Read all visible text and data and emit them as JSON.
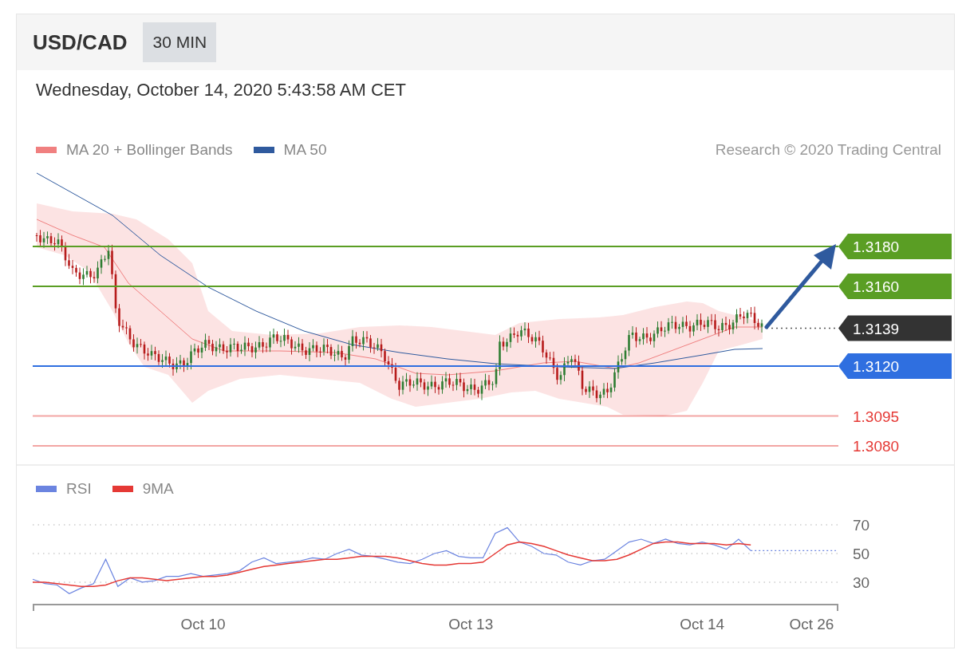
{
  "header": {
    "symbol": "USD/CAD",
    "timeframe": "30 MIN"
  },
  "timestamp": "Wednesday, October 14, 2020 5:43:58 AM CET",
  "price_chart": {
    "legend": [
      {
        "label": "MA 20 + Bollinger Bands",
        "color": "#f08080"
      },
      {
        "label": "MA 50",
        "color": "#2f5a9e"
      }
    ],
    "credit": "Research © 2020 Trading Central",
    "levels": [
      {
        "label": "1.3180",
        "kind": "tag",
        "color": "#5a9e24"
      },
      {
        "label": "1.3160",
        "kind": "tag",
        "color": "#5a9e24"
      },
      {
        "label": "1.3139",
        "kind": "current",
        "color": "#333333"
      },
      {
        "label": "1.3120",
        "kind": "tag",
        "color": "#2f6fe0"
      },
      {
        "label": "1.3095",
        "kind": "plain",
        "color": "#e53935"
      },
      {
        "label": "1.3080",
        "kind": "plain",
        "color": "#e53935"
      }
    ]
  },
  "rsi_chart": {
    "chart_data": {
      "type": "line",
      "categories": [
        null,
        null,
        null,
        null,
        null,
        null,
        null,
        null,
        null,
        null,
        null,
        null,
        null,
        null,
        "Oct 10",
        null,
        null,
        null,
        null,
        null,
        null,
        null,
        null,
        null,
        null,
        null,
        null,
        null,
        null,
        null,
        null,
        null,
        null,
        null,
        null,
        null,
        "Oct 13",
        null,
        null,
        null,
        null,
        null,
        null,
        null,
        null,
        null,
        null,
        null,
        null,
        null,
        null,
        null,
        null,
        null,
        null,
        "Oct 14",
        null,
        null,
        null,
        null,
        null,
        null,
        null,
        null,
        "Oct 26",
        null,
        null
      ],
      "series": [
        {
          "name": "RSI",
          "color": "#6b84e0",
          "values": [
            32,
            29,
            28,
            22,
            26,
            29,
            46,
            27,
            33,
            30,
            31,
            34,
            34,
            36,
            34,
            35,
            36,
            38,
            44,
            47,
            43,
            44,
            45,
            47,
            46,
            50,
            53,
            49,
            48,
            46,
            44,
            43,
            46,
            50,
            52,
            48,
            47,
            47,
            64,
            68,
            58,
            55,
            50,
            49,
            44,
            42,
            45,
            46,
            52,
            58,
            60,
            57,
            60,
            57,
            56,
            58,
            56,
            53,
            60,
            52,
            null,
            null,
            null,
            null,
            null,
            null,
            null
          ]
        },
        {
          "name": "9MA",
          "color": "#e53935",
          "values": [
            30,
            30,
            29,
            28,
            27,
            27,
            28,
            31,
            33,
            33,
            32,
            31,
            32,
            33,
            34,
            34,
            35,
            37,
            39,
            41,
            42,
            43,
            44,
            45,
            46,
            46,
            47,
            48,
            48,
            48,
            47,
            45,
            43,
            42,
            42,
            43,
            43,
            44,
            50,
            56,
            58,
            57,
            55,
            52,
            49,
            47,
            45,
            45,
            46,
            49,
            53,
            57,
            58,
            58,
            57,
            57,
            57,
            56,
            57,
            56,
            null,
            null,
            null,
            null,
            null,
            null,
            null
          ]
        },
        {
          "color": "#6b84e0",
          "line_style": "dotted",
          "values": [
            null,
            null,
            null,
            null,
            null,
            null,
            null,
            null,
            null,
            null,
            null,
            null,
            null,
            null,
            null,
            null,
            null,
            null,
            null,
            null,
            null,
            null,
            null,
            null,
            null,
            null,
            null,
            null,
            null,
            null,
            null,
            null,
            null,
            null,
            null,
            null,
            null,
            null,
            null,
            null,
            null,
            null,
            null,
            null,
            null,
            null,
            null,
            null,
            null,
            null,
            null,
            null,
            null,
            null,
            null,
            null,
            null,
            null,
            null,
            52,
            52,
            52,
            52,
            52,
            52,
            52,
            52
          ]
        }
      ],
      "ylim": [
        14.4,
        70
      ],
      "grid": true,
      "yticks": [
        30,
        50,
        70
      ]
    }
  }
}
